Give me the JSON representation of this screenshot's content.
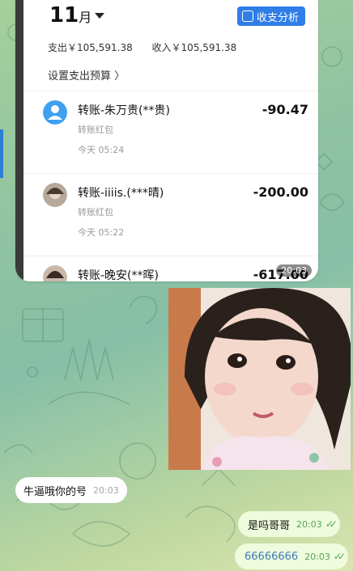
{
  "shared_screenshot": {
    "month": "11",
    "month_unit": "月",
    "analysis_button": "收支分析",
    "expense_total": "支出￥105,591.38",
    "income_total": "收入￥105,591.38",
    "budget_link": "设置支出预算 〉",
    "transactions": [
      {
        "title": "转账-朱万贵(**贵)",
        "subtitle": "转账红包",
        "time": "今天 05:24",
        "amount": "-90.47"
      },
      {
        "title": "转账-iiiis.(***晴)",
        "subtitle": "转账红包",
        "time": "今天 05:22",
        "amount": "-200.00"
      },
      {
        "title": "转账-晚安(**晖)",
        "subtitle": "",
        "time": "",
        "amount": "-617.00"
      }
    ],
    "timestamp": "20:03"
  },
  "messages": {
    "incoming_1": {
      "text": "牛逼哦你的号",
      "time": "20:03"
    },
    "outgoing_1": {
      "text": "是吗哥哥",
      "time": "20:03"
    },
    "outgoing_2": {
      "text": "66666666",
      "time": "20:03"
    }
  },
  "icons": {
    "read_ticks": "double-check-icon",
    "analysis": "chart-icon",
    "caret": "caret-down-icon"
  },
  "colors": {
    "accent_blue": "#2f7ee8",
    "outgoing_bubble": "#eefbdc",
    "tick_green": "#4ea84e"
  }
}
